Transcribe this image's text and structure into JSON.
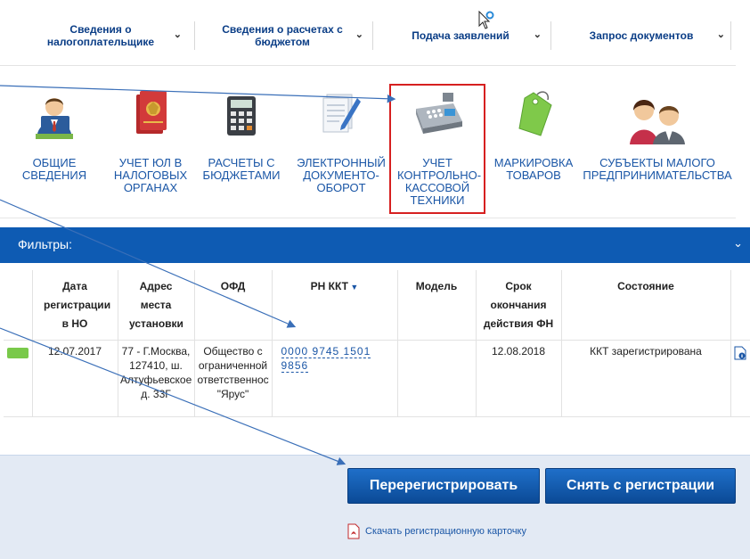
{
  "nav": {
    "items": [
      {
        "label": "Сведения о налогоплательщике"
      },
      {
        "label": "Сведения о расчетах с бюджетом"
      },
      {
        "label": "Подача заявлений"
      },
      {
        "label": "Запрос документов"
      }
    ]
  },
  "tiles": [
    {
      "label": "ОБЩИЕ СВЕДЕНИЯ",
      "icon": "person-icon"
    },
    {
      "label": "УЧЕТ ЮЛ В НАЛОГОВЫХ ОРГАНАХ",
      "icon": "folder-emblem-icon"
    },
    {
      "label": "РАСЧЕТЫ С БЮДЖЕТАМИ",
      "icon": "calculator-icon"
    },
    {
      "label": "ЭЛЕКТРОННЫЙ ДОКУМЕНТО-ОБОРОТ",
      "icon": "documents-pen-icon"
    },
    {
      "label": "УЧЕТ КОНТРОЛЬНО-КАССОВОЙ ТЕХНИКИ",
      "icon": "cash-register-icon"
    },
    {
      "label": "МАРКИРОВКА ТОВАРОВ",
      "icon": "tag-icon"
    },
    {
      "label": "СУБЪЕКТЫ МАЛОГО ПРЕДПРИНИМАТЕЛЬСТВА",
      "icon": "people-icon"
    }
  ],
  "filters": {
    "label": "Фильтры:"
  },
  "table": {
    "headers": {
      "reg_date": "Дата регистрации в НО",
      "address": "Адрес места установки",
      "ofd": "ОФД",
      "rn": "РН ККТ",
      "model": "Модель",
      "fn_expiry": "Срок окончания действия ФН",
      "status": "Состояние"
    },
    "rows": [
      {
        "reg_date": "12.07.2017",
        "address": "77 - Г.Москва, 127410, ш. Алтуфьевское д. 33Г",
        "ofd": "Общество с ограниченной ответственностью \"Ярус\"",
        "rn": "0000 9745 1501 9856",
        "model": "",
        "fn_expiry": "12.08.2018",
        "status": "ККТ зарегистрирована",
        "status_color": "#79c94a"
      }
    ]
  },
  "actions": {
    "reregister": "Перерегистрировать",
    "deregister": "Снять с регистрации",
    "download": "Скачать регистрационную карточку"
  },
  "colors": {
    "accent": "#0e5bb3",
    "link": "#1a56a6",
    "highlight": "#d62020"
  }
}
